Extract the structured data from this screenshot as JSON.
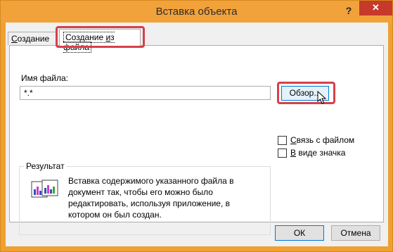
{
  "window": {
    "title": "Вставка объекта",
    "help": "?",
    "close": "✕"
  },
  "tabs": [
    {
      "label_first": "С",
      "label_rest": "оздание"
    },
    {
      "label_first": "Создание ",
      "label_acc": "и",
      "label_rest": "з файла"
    }
  ],
  "file": {
    "label": "Имя файла:",
    "value": "*.*",
    "browse_label": "Обзор..."
  },
  "options": [
    {
      "acc": "С",
      "label": "вязь с файлом",
      "checked": false
    },
    {
      "acc": "В",
      "label": " виде значка",
      "checked": false
    }
  ],
  "result": {
    "title": "Результат",
    "text": "Вставка содержимого указанного файла в документ так, чтобы его можно было редактировать, используя приложение, в котором он был создан."
  },
  "buttons": {
    "ok": "ОК",
    "cancel": "Отмена"
  },
  "colors": {
    "titlebar": "#f2a23a",
    "close": "#c7392b",
    "highlight": "#d6404b",
    "focus_border": "#0078d7"
  }
}
